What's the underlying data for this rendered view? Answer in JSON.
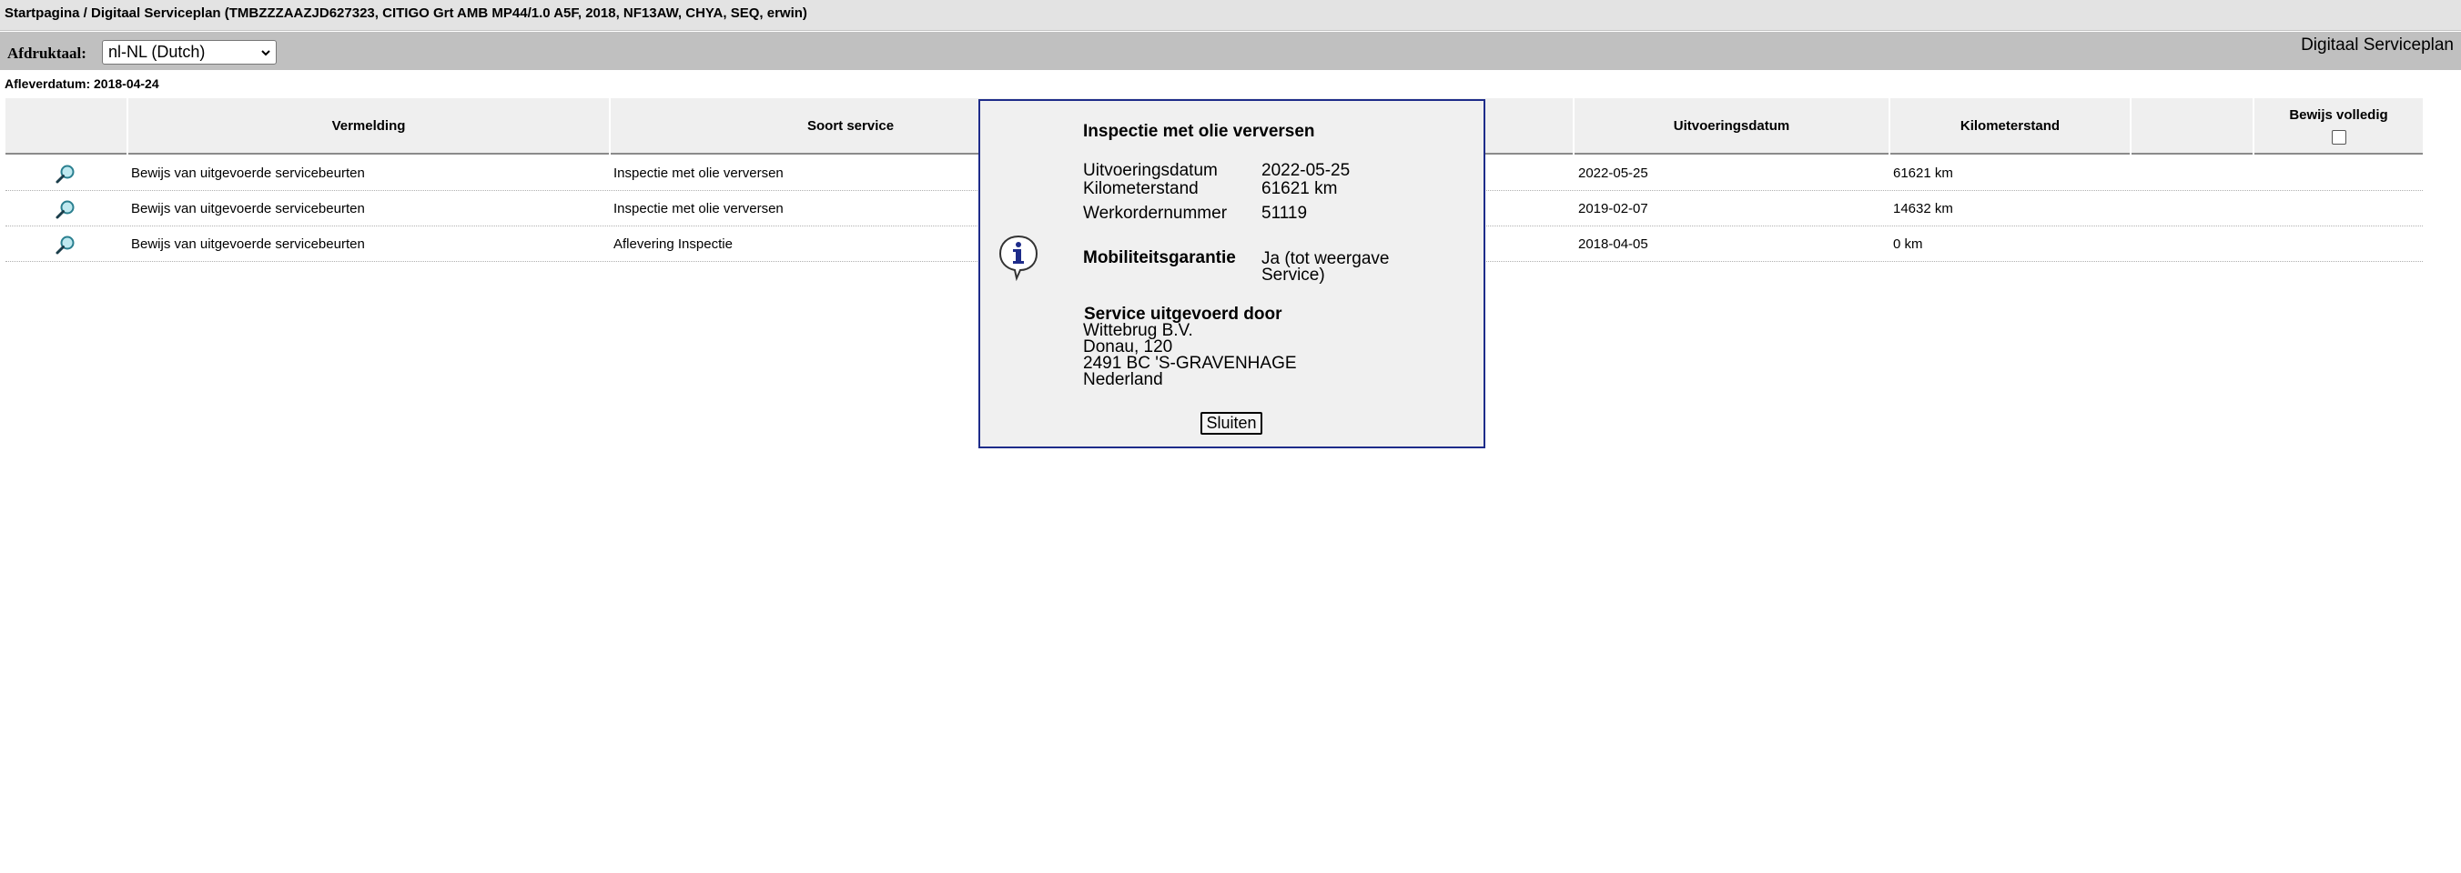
{
  "breadcrumb": "Startpagina / Digitaal Serviceplan (TMBZZZAAZJD627323, CITIGO Grt AMB MP44/1.0 A5F, 2018, NF13AW, CHYA, SEQ, erwin)",
  "toolbar": {
    "print_language_label": "Afdruktaal:",
    "print_language_value": "nl-NL (Dutch)",
    "app_title": "Digitaal Serviceplan"
  },
  "delivery_date": "Afleverdatum: 2018-04-24",
  "table": {
    "columns": {
      "entry": "Vermelding",
      "service_type": "Soort service",
      "execution_date": "Uitvoeringsdatum",
      "mileage": "Kilometerstand",
      "proof_complete": "Bewijs volledig"
    },
    "rows": [
      {
        "entry": "Bewijs van uitgevoerde servicebeurten",
        "service_type": "Inspectie met olie verversen",
        "execution_date": "2022-05-25",
        "mileage": "61621 km"
      },
      {
        "entry": "Bewijs van uitgevoerde servicebeurten",
        "service_type": "Inspectie met olie verversen",
        "execution_date": "2019-02-07",
        "mileage": "14632 km"
      },
      {
        "entry": "Bewijs van uitgevoerde servicebeurten",
        "service_type": "Aflevering Inspectie",
        "execution_date": "2018-04-05",
        "mileage": "0 km"
      }
    ]
  },
  "popup": {
    "title": "Inspectie met olie verversen",
    "fields": [
      {
        "label": "Uitvoeringsdatum",
        "value": "2022-05-25"
      },
      {
        "label": "Kilometerstand",
        "value": "61621 km"
      },
      {
        "label": "Werkordernummer",
        "value": "51119"
      }
    ],
    "mobility_label": "Mobiliteitsgarantie",
    "mobility_value_1": "Ja (tot weergave",
    "mobility_value_2": "Service)",
    "performed_by_label": "Service uitgevoerd door",
    "address": [
      "Wittebrug B.V.",
      "Donau, 120",
      "2491 BC 'S-GRAVENHAGE",
      "Nederland"
    ],
    "close_label": "Sluiten"
  },
  "colors": {
    "popup_border": "#1e2c8a",
    "toolbar_bg": "#c0c0c0",
    "header_bg": "#efefef"
  },
  "icons": {
    "row_action": "magnifier-icon",
    "popup": "info-icon"
  }
}
